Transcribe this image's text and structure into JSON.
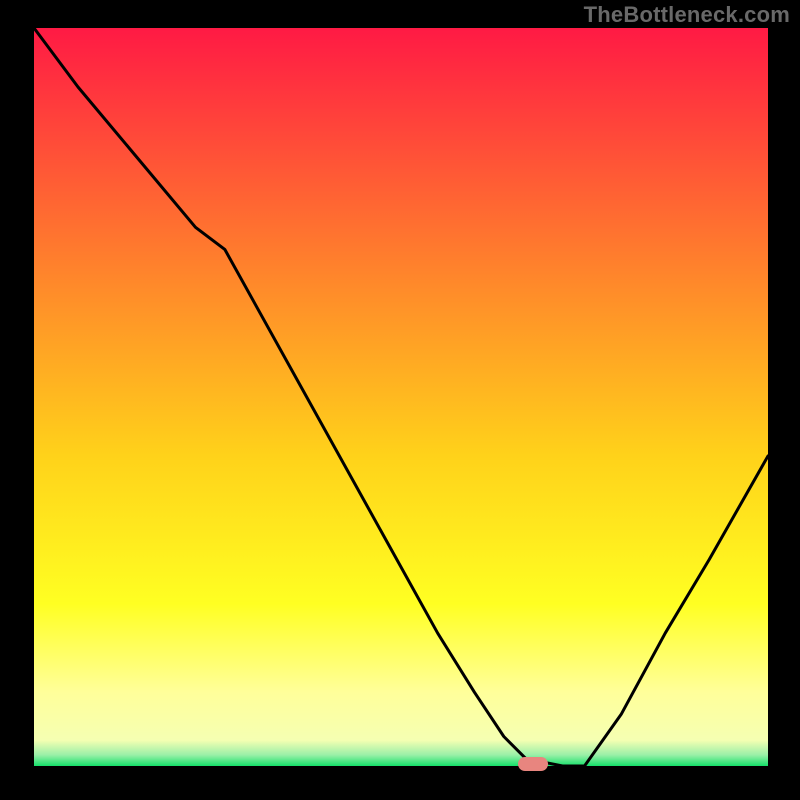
{
  "watermark": "TheBottleneck.com",
  "colors": {
    "bg": "#000000",
    "grad_top": "#ff1a44",
    "grad_mid1": "#ff8a2a",
    "grad_mid2": "#ffd21a",
    "grad_yellow": "#ffff22",
    "grad_pale": "#ffff9a",
    "grad_green": "#15e06a",
    "curve": "#000000",
    "marker": "#e8857f",
    "watermark": "#696969"
  },
  "chart_data": {
    "type": "line",
    "title": "",
    "xlabel": "",
    "ylabel": "",
    "xlim": [
      0,
      100
    ],
    "ylim": [
      0,
      100
    ],
    "x": [
      0,
      6,
      22,
      26,
      55,
      60,
      64,
      67,
      72,
      75,
      80,
      86,
      92,
      100
    ],
    "y": [
      100,
      92,
      73,
      70,
      18,
      10,
      4,
      1,
      0,
      0,
      7,
      18,
      28,
      42
    ],
    "marker": {
      "x": 68,
      "y": 0
    },
    "gradient_stops": [
      {
        "offset": 0.0,
        "color": "#ff1a44"
      },
      {
        "offset": 0.35,
        "color": "#ff8a2a"
      },
      {
        "offset": 0.58,
        "color": "#ffd21a"
      },
      {
        "offset": 0.78,
        "color": "#ffff22"
      },
      {
        "offset": 0.9,
        "color": "#ffff9a"
      },
      {
        "offset": 0.965,
        "color": "#f5ffb2"
      },
      {
        "offset": 0.985,
        "color": "#9af0a8"
      },
      {
        "offset": 1.0,
        "color": "#15e06a"
      }
    ]
  }
}
